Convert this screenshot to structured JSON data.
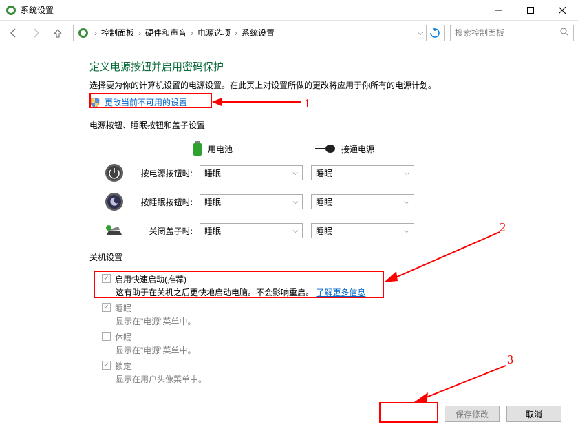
{
  "window": {
    "title": "系统设置"
  },
  "breadcrumb": {
    "seg1": "控制面板",
    "seg2": "硬件和声音",
    "seg3": "电源选项",
    "seg4": "系统设置"
  },
  "search": {
    "placeholder": "搜索控制面板"
  },
  "heading": "定义电源按钮并启用密码保护",
  "subtext": "选择要为你的计算机设置的电源设置。在此页上对设置所做的更改将应用于你所有的电源计划。",
  "change_link": "更改当前不可用的设置",
  "section_buttons": "电源按钮、睡眠按钮和盖子设置",
  "col_battery": "用电池",
  "col_ac": "接通电源",
  "row_power_button": "按电源按钮时:",
  "row_sleep_button": "按睡眠按钮时:",
  "row_close_lid": "关闭盖子时:",
  "dropdown_value": "睡眠",
  "section_shutdown": "关机设置",
  "cb_fast_startup": {
    "label": "启用快速启动(推荐)",
    "desc_prefix": "这有助于在关机之后更快地启动电脑。不会影响重启。",
    "desc_link": "了解更多信息"
  },
  "cb_sleep": {
    "label": "睡眠",
    "desc": "显示在\"电源\"菜单中。"
  },
  "cb_hibernate": {
    "label": "休眠",
    "desc": "显示在\"电源\"菜单中。"
  },
  "cb_lock": {
    "label": "锁定",
    "desc": "显示在用户头像菜单中。"
  },
  "btn_save": "保存修改",
  "btn_cancel": "取消",
  "annotations": {
    "n1": "1",
    "n2": "2",
    "n3": "3"
  }
}
